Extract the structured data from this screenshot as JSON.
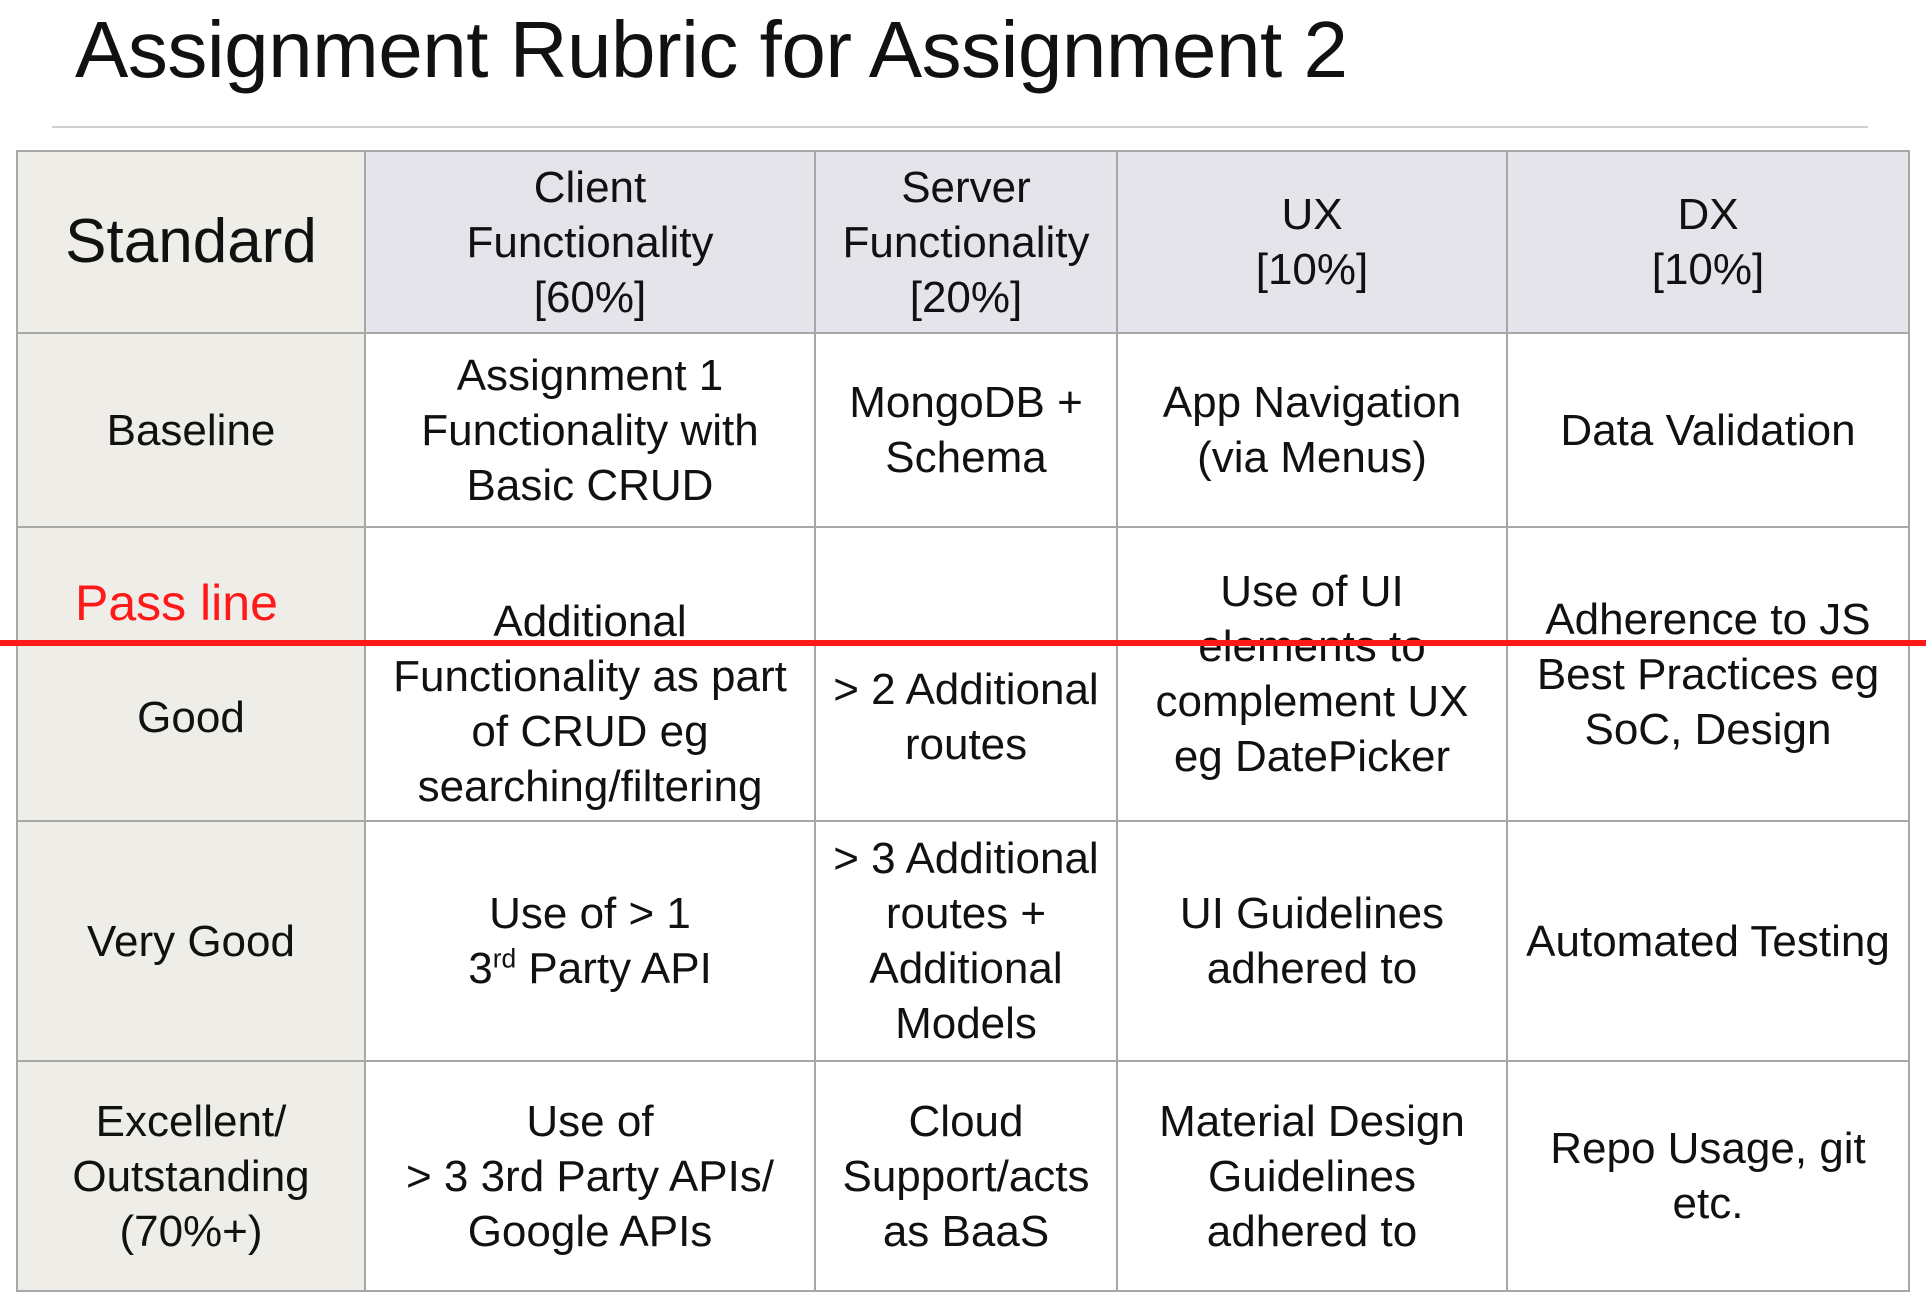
{
  "title": "Assignment Rubric for Assignment 2",
  "header": {
    "standard": "Standard",
    "columns": [
      "Client\nFunctionality\n[60%]",
      "Server\nFunctionality\n[20%]",
      "UX\n[10%]",
      "DX\n[10%]"
    ]
  },
  "rows": [
    {
      "standard": "Baseline",
      "cells": [
        "Assignment 1\nFunctionality with\nBasic CRUD",
        "MongoDB +\nSchema",
        "App Navigation\n(via Menus)",
        "Data Validation"
      ]
    },
    {
      "standard": "Good",
      "cells": [
        "Additional\nFunctionality as part\nof CRUD eg\nsearching/filtering",
        "> 2 Additional\nroutes",
        "Use of UI\nelements to\ncomplement UX\neg DatePicker",
        "Adherence to JS\nBest Practices eg\nSoC, Design"
      ]
    },
    {
      "standard": "Very Good",
      "cells": [
        {
          "prefix": "Use of > 1\n3",
          "sup": "rd",
          "suffix": " Party API"
        },
        "> 3 Additional\nroutes +\nAdditional\nModels",
        "UI Guidelines\nadhered to",
        "Automated Testing"
      ]
    },
    {
      "standard": "Excellent/\nOutstanding\n(70%+)",
      "cells": [
        "Use of\n> 3 3rd Party APIs/\nGoogle APIs",
        "Cloud\nSupport/acts\nas BaaS",
        "Material Design\nGuidelines\nadhered to",
        "Repo Usage, git\netc."
      ]
    }
  ],
  "pass_line": {
    "label": "Pass line",
    "color": "#ff1a1a"
  }
}
